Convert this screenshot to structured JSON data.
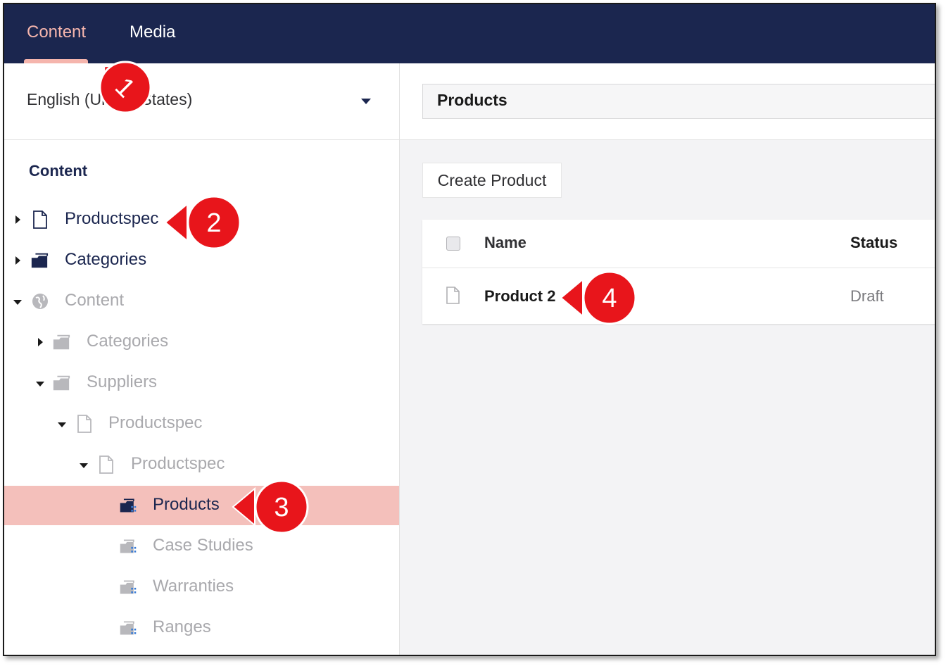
{
  "top_nav": {
    "tabs": [
      {
        "label": "Content",
        "active": true
      },
      {
        "label": "Media",
        "active": false
      }
    ]
  },
  "sidebar": {
    "language": "English (United States)",
    "tree_heading": "Content",
    "nodes": [
      {
        "label": "Productspec",
        "icon": "document-icon",
        "dim": false
      },
      {
        "label": "Categories",
        "icon": "folder-icon",
        "dim": false
      },
      {
        "label": "Content",
        "icon": "globe-icon",
        "dim": true
      },
      {
        "label": "Categories",
        "icon": "folder-icon",
        "dim": true
      },
      {
        "label": "Suppliers",
        "icon": "folder-icon",
        "dim": true
      },
      {
        "label": "Productspec",
        "icon": "document-icon",
        "dim": true
      },
      {
        "label": "Productspec",
        "icon": "document-icon",
        "dim": true
      },
      {
        "label": "Products",
        "icon": "list-folder-icon",
        "selected": true
      },
      {
        "label": "Case Studies",
        "icon": "list-folder-icon",
        "dim": true
      },
      {
        "label": "Warranties",
        "icon": "list-folder-icon",
        "dim": true
      },
      {
        "label": "Ranges",
        "icon": "list-folder-icon",
        "dim": true
      }
    ]
  },
  "main": {
    "node_name": "Products",
    "create_button": "Create Product",
    "table": {
      "headers": {
        "name": "Name",
        "status": "Status"
      },
      "rows": [
        {
          "name": "Product 2",
          "status": "Draft"
        }
      ]
    }
  },
  "callouts": [
    "1",
    "2",
    "3",
    "4"
  ],
  "colors": {
    "topbar": "#1b264f",
    "accent": "#f5b5ad",
    "selected_row": "#f4c0bb",
    "callout": "#e8151b"
  }
}
